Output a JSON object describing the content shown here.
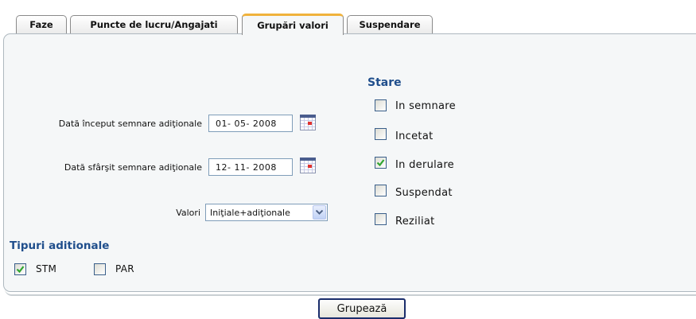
{
  "tabs": [
    {
      "label": "Faze"
    },
    {
      "label": "Puncte de lucru/Angajati"
    },
    {
      "label": "Grupări valori"
    },
    {
      "label": "Suspendare"
    }
  ],
  "active_tab": "Grupări valori",
  "form": {
    "start_date_label": "Dată început semnare adiţionale",
    "start_date_value": "01- 05-  2008",
    "end_date_label": "Dată sfârşit semnare adiţionale",
    "end_date_value": "12- 11-  2008",
    "valori_label": "Valori",
    "valori_selected": "Iniţiale+adiţionale"
  },
  "tipuri": {
    "title": "Tipuri aditionale",
    "options": [
      {
        "label": "STM",
        "checked": true
      },
      {
        "label": "PAR",
        "checked": false
      }
    ]
  },
  "stare": {
    "title": "Stare",
    "options": [
      {
        "label": "In semnare",
        "checked": false
      },
      {
        "label": "Incetat",
        "checked": false
      },
      {
        "label": "In derulare",
        "checked": true
      },
      {
        "label": "Suspendat",
        "checked": false
      },
      {
        "label": "Reziliat",
        "checked": false
      }
    ]
  },
  "submit_label": "Grupează",
  "colors": {
    "accent_tab": "#f0b23c",
    "heading": "#1f4e8c",
    "check": "#2fa52f"
  },
  "icons": [
    "calendar-icon",
    "dropdown-arrow-icon",
    "checkmark-icon"
  ]
}
